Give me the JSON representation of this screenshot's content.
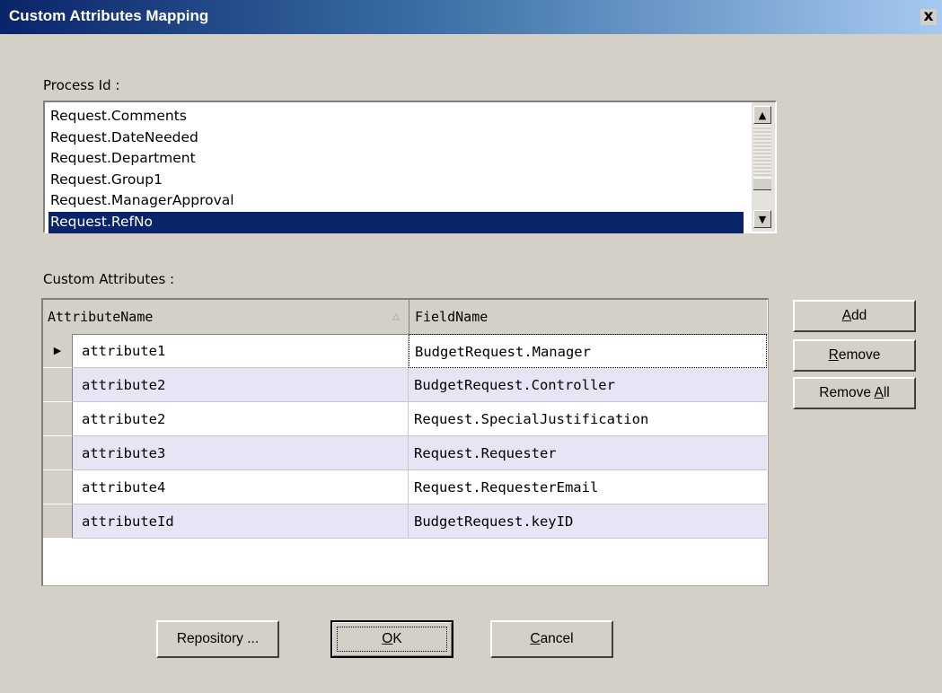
{
  "window": {
    "title": "Custom Attributes Mapping",
    "close_glyph": "x"
  },
  "process_id": {
    "label": "Process Id :",
    "items": [
      "Request.Comments",
      "Request.DateNeeded",
      "Request.Department",
      "Request.Group1",
      "Request.ManagerApproval",
      "Request.RefNo"
    ],
    "selected": "Request.RefNo"
  },
  "custom_attributes": {
    "label": "Custom Attributes :",
    "columns": [
      "AttributeName",
      "FieldName"
    ],
    "sort_indicator": "△",
    "rows": [
      {
        "attribute": "attribute1",
        "field": "BudgetRequest.Manager"
      },
      {
        "attribute": "attribute2",
        "field": "BudgetRequest.Controller"
      },
      {
        "attribute": "attribute2",
        "field": "Request.SpecialJustification"
      },
      {
        "attribute": "attribute3",
        "field": "Request.Requester"
      },
      {
        "attribute": "attribute4",
        "field": "Request.RequesterEmail"
      },
      {
        "attribute": "attributeId",
        "field": "BudgetRequest.keyID"
      }
    ]
  },
  "side_buttons": {
    "add": {
      "before": "",
      "accel": "A",
      "after": "dd"
    },
    "remove": {
      "before": "",
      "accel": "R",
      "after": "emove"
    },
    "remove_all": {
      "before": "Remove ",
      "accel": "A",
      "after": "ll"
    }
  },
  "footer_buttons": {
    "repository": "Repository ...",
    "ok": {
      "before": "",
      "accel": "O",
      "after": "K"
    },
    "cancel": {
      "before": "",
      "accel": "C",
      "after": "ancel"
    }
  }
}
